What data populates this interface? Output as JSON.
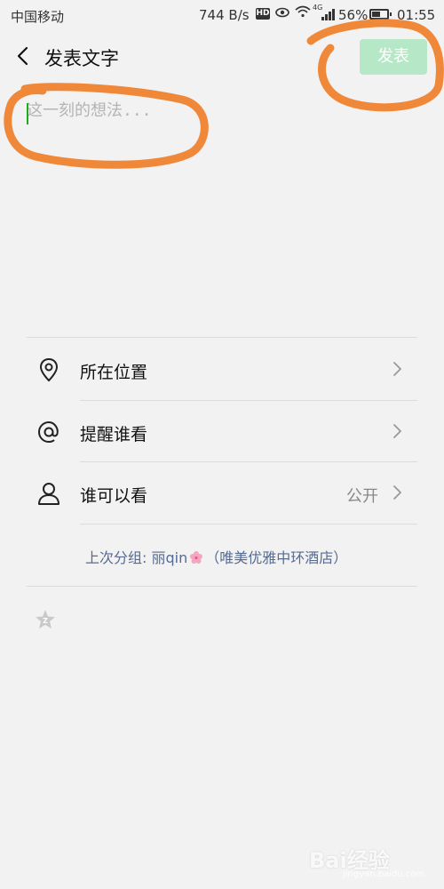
{
  "status_bar": {
    "carrier": "中国移动",
    "speed": "744 B/s",
    "hd": "HD",
    "net_type": "4G",
    "battery_pct": "56%",
    "battery_level": 0.56,
    "time": "01:55"
  },
  "header": {
    "title": "发表文字",
    "post_label": "发表"
  },
  "composer": {
    "placeholder": "这一刻的想法..."
  },
  "options": [
    {
      "label": "所在位置",
      "value": "",
      "icon": "location-pin-icon"
    },
    {
      "label": "提醒谁看",
      "value": "",
      "icon": "at-sign-icon"
    },
    {
      "label": "谁可以看",
      "value": "公开",
      "icon": "person-icon"
    }
  ],
  "last_group": {
    "prefix": "上次分组: 丽qin",
    "suffix": "（唯美优雅中环酒店）"
  },
  "watermark": {
    "text": "Bai经验",
    "sub": "jingyan.baidu.com"
  },
  "colors": {
    "accent": "#1aad19",
    "post_button_disabled": "#b6e8c8",
    "annotation": "#f0883a",
    "link": "#566b94"
  }
}
